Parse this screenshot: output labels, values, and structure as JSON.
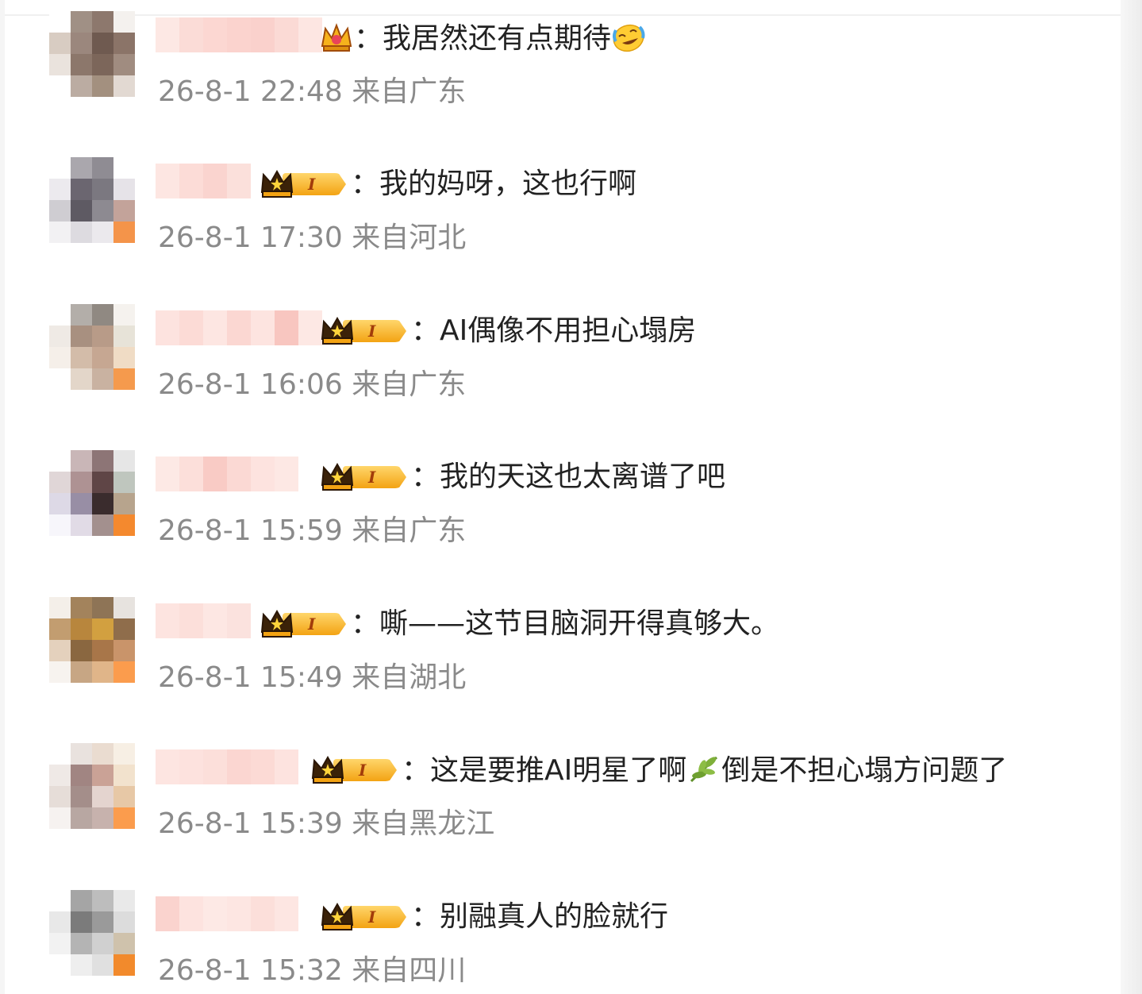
{
  "comments": [
    {
      "text": "：我居然还有点期待",
      "emoji": "laugh-cry-icon",
      "time": "26-8-1 22:48",
      "location": "来自广东",
      "level": ""
    },
    {
      "text": "：我的妈呀，这也行啊",
      "time": "26-8-1 17:30",
      "location": "来自河北",
      "level": "I"
    },
    {
      "text": "：AI偶像不用担心塌房",
      "time": "26-8-1 16:06",
      "location": "来自广东",
      "level": "I"
    },
    {
      "text": "：我的天这也太离谱了吧",
      "time": "26-8-1 15:59",
      "location": "来自广东",
      "level": "I"
    },
    {
      "text": "：嘶——这节目脑洞开得真够大。",
      "time": "26-8-1 15:49",
      "location": "来自湖北",
      "level": "I"
    },
    {
      "text_a": "：这是要推AI明星了啊",
      "emoji": "leaf-icon",
      "text_b": "倒是不担心塌方问题了",
      "time": "26-8-1 15:39",
      "location": "来自黑龙江",
      "level": "I"
    },
    {
      "text": "：别融真人的脸就行",
      "time": "26-8-1 15:32",
      "location": "来自四川",
      "level": "I"
    }
  ],
  "colors": {
    "text": "#222222",
    "meta": "#8a8a8a",
    "badge_gold": "#f3a313",
    "name_blur": "#f9cfca"
  }
}
